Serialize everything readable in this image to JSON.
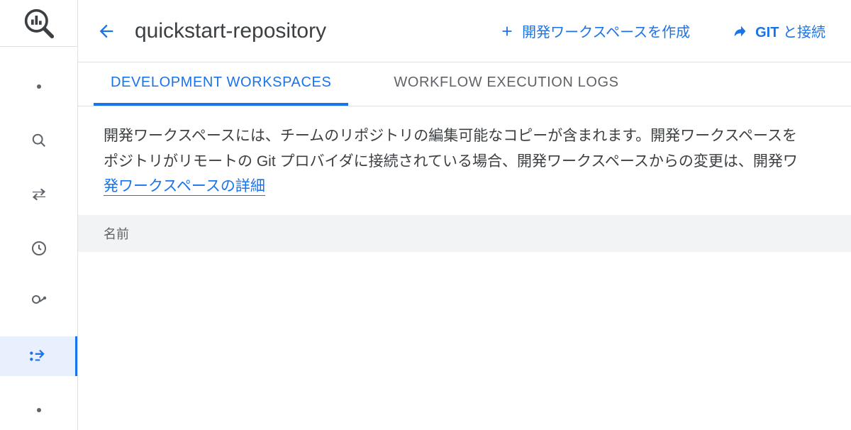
{
  "header": {
    "title": "quickstart-repository",
    "create_label": "開発ワークスペースを作成",
    "git_label_prefix": "GIT",
    "git_label_suffix": " と接続"
  },
  "tabs": {
    "dev": "DEVELOPMENT WORKSPACES",
    "logs": "WORKFLOW EXECUTION LOGS"
  },
  "description": {
    "line1": "開発ワークスペースには、チームのリポジトリの編集可能なコピーが含まれます。開発ワークスペースを",
    "line2": "ポジトリがリモートの Git プロバイダに接続されている場合、開発ワークスペースからの変更は、開発ワ",
    "link": "発ワークスペースの詳細"
  },
  "table": {
    "name_header": "名前"
  }
}
